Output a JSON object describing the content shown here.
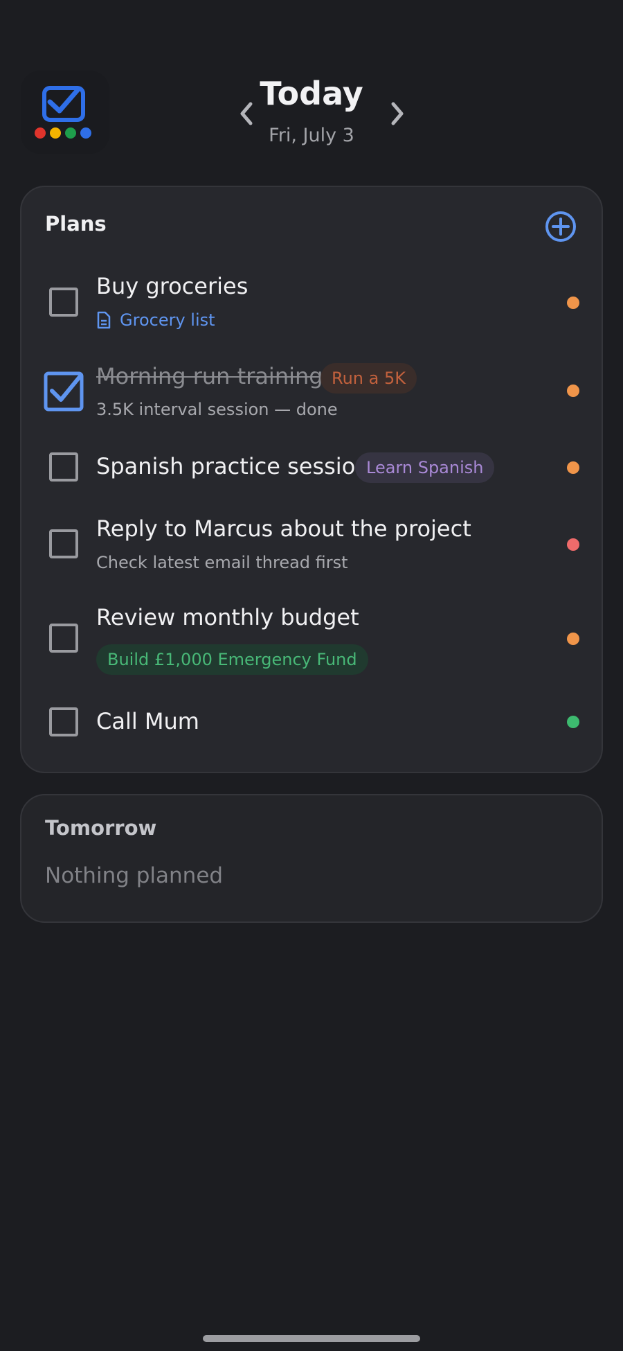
{
  "header": {
    "title": "Today",
    "date": "Fri, July 3"
  },
  "plans": {
    "title": "Plans",
    "tasks": [
      {
        "title": "Buy groceries",
        "link_label": "Grocery list",
        "checked": false,
        "dot_color": "#f0954a"
      },
      {
        "title": "Morning run training",
        "tag": "Run a 5K",
        "subtitle": "3.5K interval session — done",
        "checked": true,
        "dot_color": "#f0954a"
      },
      {
        "title": "Spanish practice session",
        "tag": "Learn Spanish",
        "checked": false,
        "dot_color": "#f0954a"
      },
      {
        "title": "Reply to Marcus about the project",
        "subtitle": "Check latest email thread first",
        "checked": false,
        "dot_color": "#ef6b6b"
      },
      {
        "title": "Review monthly budget",
        "tag": "Build £1,000 Emergency Fund",
        "checked": false,
        "dot_color": "#f0954a"
      },
      {
        "title": "Call Mum",
        "checked": false,
        "dot_color": "#3dba6f"
      }
    ]
  },
  "tomorrow": {
    "title": "Tomorrow",
    "empty_text": "Nothing planned"
  },
  "colors": {
    "accent": "#5f95f0",
    "background": "#1c1d21",
    "card": "#27282d"
  },
  "icons": {
    "app": "checklist-app-icon",
    "prev": "chevron-left-icon",
    "next": "chevron-right-icon",
    "add": "plus-circle-icon",
    "link": "document-icon",
    "checked": "checkbox-checked-icon"
  }
}
